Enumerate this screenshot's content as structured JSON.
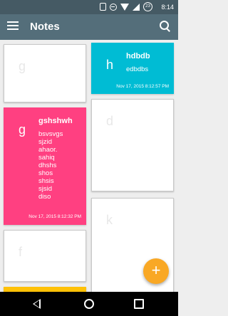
{
  "status_bar": {
    "time": "8:14",
    "battery_level": "23"
  },
  "app_bar": {
    "title": "Notes"
  },
  "notes": [
    {
      "letter": "g",
      "color": "#ffffff",
      "title": "",
      "body": "",
      "date": ""
    },
    {
      "letter": "h",
      "color": "#00bcd4",
      "title": "hdbdb",
      "body": "edbdbs",
      "date": "Nov 17, 2015 8:12:57 PM"
    },
    {
      "letter": "g",
      "color": "#ff4081",
      "title": "gshshwh",
      "body": "bsvsvgs\nsjzid\nahaor.\nsahiq\ndhshs\nshos\nshsis\nsjsid\ndiso",
      "date": "Nov 17, 2015 8:12:32 PM"
    },
    {
      "letter": "d",
      "color": "#ffffff",
      "title": "",
      "body": "",
      "date": ""
    },
    {
      "letter": "f",
      "color": "#ffffff",
      "title": "",
      "body": "",
      "date": ""
    },
    {
      "letter": "k",
      "color": "#ffffff",
      "title": "",
      "body": "",
      "date": ""
    },
    {
      "letter": "",
      "color": "#ffc107",
      "title": "",
      "body": "",
      "date": ""
    }
  ],
  "fab": {
    "label": "+"
  },
  "colors": {
    "statusbar": "#455a64",
    "appbar": "#546e7a",
    "fab": "#f9a825"
  }
}
